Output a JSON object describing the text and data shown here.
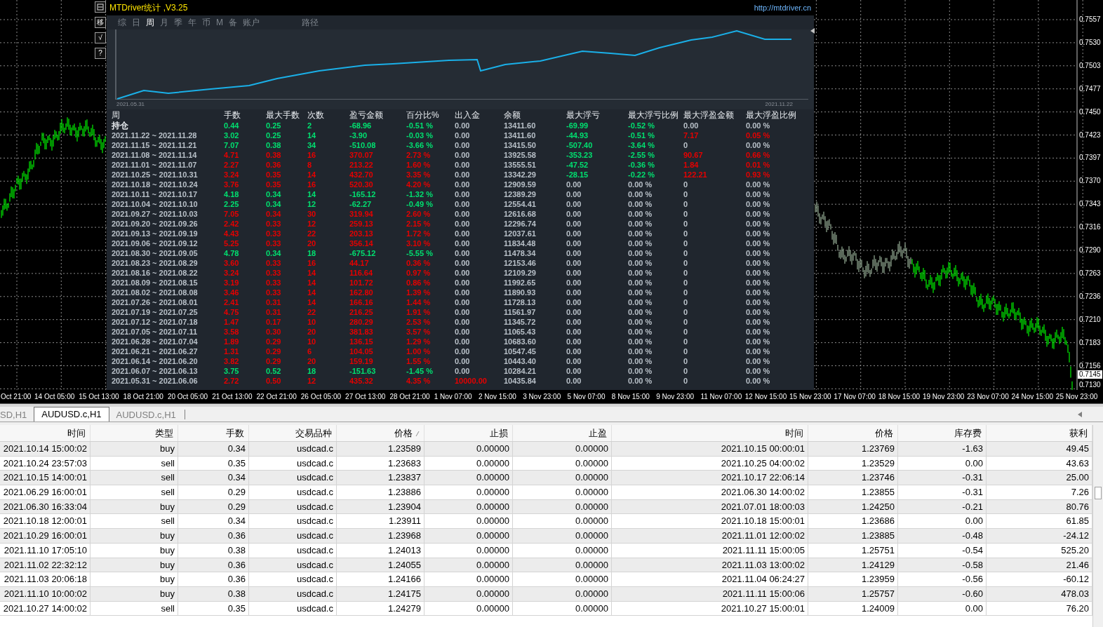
{
  "chart": {
    "price_ticks": [
      "0.7557",
      "0.7530",
      "0.7503",
      "0.7477",
      "0.7450",
      "0.7423",
      "0.7397",
      "0.7370",
      "0.7343",
      "0.7316",
      "0.7290",
      "0.7263",
      "0.7236",
      "0.7210",
      "0.7183",
      "0.7156",
      "0.7130"
    ],
    "current_price": "0.7145",
    "time_labels": [
      "Oct 21:00",
      "14 Oct 05:00",
      "15 Oct 13:00",
      "18 Oct 21:00",
      "20 Oct 05:00",
      "21 Oct 13:00",
      "22 Oct 21:00",
      "26 Oct 05:00",
      "27 Oct 13:00",
      "28 Oct 21:00",
      "1 Nov 07:00",
      "2 Nov 15:00",
      "3 Nov 23:00",
      "5 Nov 07:00",
      "8 Nov 15:00",
      "9 Nov 23:00",
      "11 Nov 07:00",
      "12 Nov 15:00",
      "15 Nov 23:00",
      "17 Nov 07:00",
      "18 Nov 15:00",
      "19 Nov 23:00",
      "23 Nov 07:00",
      "24 Nov 15:00",
      "25 Nov 23:00"
    ]
  },
  "panel": {
    "title": "MTDriver统计 ,V3.25",
    "url": "http://mtdriver.cn",
    "side_buttons": [
      {
        "kind": "minimize"
      },
      {
        "kind": "text",
        "label": "移"
      },
      {
        "kind": "text",
        "label": "√"
      },
      {
        "kind": "text",
        "label": "?"
      }
    ],
    "tabs": [
      {
        "label": "综",
        "selected": false
      },
      {
        "label": "日",
        "selected": false
      },
      {
        "label": "周",
        "selected": true
      },
      {
        "label": "月",
        "selected": false
      },
      {
        "label": "季",
        "selected": false
      },
      {
        "label": "年",
        "selected": false
      },
      {
        "label": "币",
        "selected": false
      },
      {
        "label": "M",
        "selected": false
      },
      {
        "label": "备",
        "selected": false
      },
      {
        "label": "账户",
        "selected": false
      }
    ],
    "path_label": "路径",
    "equity_chart": {
      "start_label": "2021.05.31",
      "end_label": "2021.11.22"
    },
    "stats": {
      "columns": [
        "周",
        "手数",
        "最大手数",
        "次数",
        "盈亏金额",
        "百分比%",
        "出入金",
        "余额",
        "最大浮亏",
        "最大浮亏比例",
        "最大浮盈金额",
        "最大浮盈比例"
      ],
      "rows": [
        [
          {
            "text": "持仓",
            "color": "#e8ecf0"
          },
          {
            "text": "0.44",
            "color": "#00e070"
          },
          {
            "text": "0.25",
            "color": "#00e070"
          },
          {
            "text": "2",
            "color": "#00e070"
          },
          {
            "text": "-68.96",
            "color": "#00e070"
          },
          {
            "text": "-0.51 %",
            "color": "#00e070"
          },
          {
            "text": "0.00",
            "color": "#b8c0c8"
          },
          {
            "text": "13411.60",
            "color": "#b8c0c8"
          },
          {
            "text": "-69.99",
            "color": "#00e070"
          },
          {
            "text": "-0.52 %",
            "color": "#00e070"
          },
          {
            "text": "0.00",
            "color": "#b8c0c8"
          },
          {
            "text": "0.00 %",
            "color": "#b8c0c8"
          }
        ],
        [
          {
            "text": "2021.11.22 ~ 2021.11.28",
            "color": "#b8c0c8"
          },
          {
            "text": "3.02",
            "color": "#00e070"
          },
          {
            "text": "0.25",
            "color": "#00e070"
          },
          {
            "text": "14",
            "color": "#00e070"
          },
          {
            "text": "-3.90",
            "color": "#00e070"
          },
          {
            "text": "-0.03 %",
            "color": "#00e070"
          },
          {
            "text": "0.00",
            "color": "#b8c0c8"
          },
          {
            "text": "13411.60",
            "color": "#b8c0c8"
          },
          {
            "text": "-44.93",
            "color": "#00e070"
          },
          {
            "text": "-0.51 %",
            "color": "#00e070"
          },
          {
            "text": "7.17",
            "color": "#e60000"
          },
          {
            "text": "0.05 %",
            "color": "#e60000"
          }
        ],
        [
          {
            "text": "2021.11.15 ~ 2021.11.21",
            "color": "#b8c0c8"
          },
          {
            "text": "7.07",
            "color": "#00e070"
          },
          {
            "text": "0.38",
            "color": "#00e070"
          },
          {
            "text": "34",
            "color": "#00e070"
          },
          {
            "text": "-510.08",
            "color": "#00e070"
          },
          {
            "text": "-3.66 %",
            "color": "#00e070"
          },
          {
            "text": "0.00",
            "color": "#b8c0c8"
          },
          {
            "text": "13415.50",
            "color": "#b8c0c8"
          },
          {
            "text": "-507.40",
            "color": "#00e070"
          },
          {
            "text": "-3.64 %",
            "color": "#00e070"
          },
          {
            "text": "0",
            "color": "#b8c0c8"
          },
          {
            "text": "0.00 %",
            "color": "#b8c0c8"
          }
        ],
        [
          {
            "text": "2021.11.08 ~ 2021.11.14",
            "color": "#b8c0c8"
          },
          {
            "text": "4.71",
            "color": "#e60000"
          },
          {
            "text": "0.38",
            "color": "#e60000"
          },
          {
            "text": "16",
            "color": "#e60000"
          },
          {
            "text": "370.07",
            "color": "#e60000"
          },
          {
            "text": "2.73 %",
            "color": "#e60000"
          },
          {
            "text": "0.00",
            "color": "#b8c0c8"
          },
          {
            "text": "13925.58",
            "color": "#b8c0c8"
          },
          {
            "text": "-353.23",
            "color": "#00e070"
          },
          {
            "text": "-2.55 %",
            "color": "#00e070"
          },
          {
            "text": "90.67",
            "color": "#e60000"
          },
          {
            "text": "0.66 %",
            "color": "#e60000"
          }
        ],
        [
          {
            "text": "2021.11.01 ~ 2021.11.07",
            "color": "#b8c0c8"
          },
          {
            "text": "2.27",
            "color": "#e60000"
          },
          {
            "text": "0.36",
            "color": "#e60000"
          },
          {
            "text": "8",
            "color": "#e60000"
          },
          {
            "text": "213.22",
            "color": "#e60000"
          },
          {
            "text": "1.60 %",
            "color": "#e60000"
          },
          {
            "text": "0.00",
            "color": "#b8c0c8"
          },
          {
            "text": "13555.51",
            "color": "#b8c0c8"
          },
          {
            "text": "-47.52",
            "color": "#00e070"
          },
          {
            "text": "-0.36 %",
            "color": "#00e070"
          },
          {
            "text": "1.84",
            "color": "#e60000"
          },
          {
            "text": "0.01 %",
            "color": "#e60000"
          }
        ],
        [
          {
            "text": "2021.10.25 ~ 2021.10.31",
            "color": "#b8c0c8"
          },
          {
            "text": "3.24",
            "color": "#e60000"
          },
          {
            "text": "0.35",
            "color": "#e60000"
          },
          {
            "text": "14",
            "color": "#e60000"
          },
          {
            "text": "432.70",
            "color": "#e60000"
          },
          {
            "text": "3.35 %",
            "color": "#e60000"
          },
          {
            "text": "0.00",
            "color": "#b8c0c8"
          },
          {
            "text": "13342.29",
            "color": "#b8c0c8"
          },
          {
            "text": "-28.15",
            "color": "#00e070"
          },
          {
            "text": "-0.22 %",
            "color": "#00e070"
          },
          {
            "text": "122.21",
            "color": "#e60000"
          },
          {
            "text": "0.93 %",
            "color": "#e60000"
          }
        ],
        [
          {
            "text": "2021.10.18 ~ 2021.10.24",
            "color": "#b8c0c8"
          },
          {
            "text": "3.76",
            "color": "#e60000"
          },
          {
            "text": "0.35",
            "color": "#e60000"
          },
          {
            "text": "16",
            "color": "#e60000"
          },
          {
            "text": "520.30",
            "color": "#e60000"
          },
          {
            "text": "4.20 %",
            "color": "#e60000"
          },
          {
            "text": "0.00",
            "color": "#b8c0c8"
          },
          {
            "text": "12909.59",
            "color": "#b8c0c8"
          },
          {
            "text": "0.00",
            "color": "#b8c0c8"
          },
          {
            "text": "0.00 %",
            "color": "#b8c0c8"
          },
          {
            "text": "0",
            "color": "#b8c0c8"
          },
          {
            "text": "0.00 %",
            "color": "#b8c0c8"
          }
        ],
        [
          {
            "text": "2021.10.11 ~ 2021.10.17",
            "color": "#b8c0c8"
          },
          {
            "text": "4.18",
            "color": "#00e070"
          },
          {
            "text": "0.34",
            "color": "#00e070"
          },
          {
            "text": "14",
            "color": "#00e070"
          },
          {
            "text": "-165.12",
            "color": "#00e070"
          },
          {
            "text": "-1.32 %",
            "color": "#00e070"
          },
          {
            "text": "0.00",
            "color": "#b8c0c8"
          },
          {
            "text": "12389.29",
            "color": "#b8c0c8"
          },
          {
            "text": "0.00",
            "color": "#b8c0c8"
          },
          {
            "text": "0.00 %",
            "color": "#b8c0c8"
          },
          {
            "text": "0",
            "color": "#b8c0c8"
          },
          {
            "text": "0.00 %",
            "color": "#b8c0c8"
          }
        ],
        [
          {
            "text": "2021.10.04 ~ 2021.10.10",
            "color": "#b8c0c8"
          },
          {
            "text": "2.25",
            "color": "#00e070"
          },
          {
            "text": "0.34",
            "color": "#00e070"
          },
          {
            "text": "12",
            "color": "#00e070"
          },
          {
            "text": "-62.27",
            "color": "#00e070"
          },
          {
            "text": "-0.49 %",
            "color": "#00e070"
          },
          {
            "text": "0.00",
            "color": "#b8c0c8"
          },
          {
            "text": "12554.41",
            "color": "#b8c0c8"
          },
          {
            "text": "0.00",
            "color": "#b8c0c8"
          },
          {
            "text": "0.00 %",
            "color": "#b8c0c8"
          },
          {
            "text": "0",
            "color": "#b8c0c8"
          },
          {
            "text": "0.00 %",
            "color": "#b8c0c8"
          }
        ],
        [
          {
            "text": "2021.09.27 ~ 2021.10.03",
            "color": "#b8c0c8"
          },
          {
            "text": "7.05",
            "color": "#e60000"
          },
          {
            "text": "0.34",
            "color": "#e60000"
          },
          {
            "text": "30",
            "color": "#e60000"
          },
          {
            "text": "319.94",
            "color": "#e60000"
          },
          {
            "text": "2.60 %",
            "color": "#e60000"
          },
          {
            "text": "0.00",
            "color": "#b8c0c8"
          },
          {
            "text": "12616.68",
            "color": "#b8c0c8"
          },
          {
            "text": "0.00",
            "color": "#b8c0c8"
          },
          {
            "text": "0.00 %",
            "color": "#b8c0c8"
          },
          {
            "text": "0",
            "color": "#b8c0c8"
          },
          {
            "text": "0.00 %",
            "color": "#b8c0c8"
          }
        ],
        [
          {
            "text": "2021.09.20 ~ 2021.09.26",
            "color": "#b8c0c8"
          },
          {
            "text": "2.42",
            "color": "#e60000"
          },
          {
            "text": "0.33",
            "color": "#e60000"
          },
          {
            "text": "12",
            "color": "#e60000"
          },
          {
            "text": "259.13",
            "color": "#e60000"
          },
          {
            "text": "2.15 %",
            "color": "#e60000"
          },
          {
            "text": "0.00",
            "color": "#b8c0c8"
          },
          {
            "text": "12296.74",
            "color": "#b8c0c8"
          },
          {
            "text": "0.00",
            "color": "#b8c0c8"
          },
          {
            "text": "0.00 %",
            "color": "#b8c0c8"
          },
          {
            "text": "0",
            "color": "#b8c0c8"
          },
          {
            "text": "0.00 %",
            "color": "#b8c0c8"
          }
        ],
        [
          {
            "text": "2021.09.13 ~ 2021.09.19",
            "color": "#b8c0c8"
          },
          {
            "text": "4.43",
            "color": "#e60000"
          },
          {
            "text": "0.33",
            "color": "#e60000"
          },
          {
            "text": "22",
            "color": "#e60000"
          },
          {
            "text": "203.13",
            "color": "#e60000"
          },
          {
            "text": "1.72 %",
            "color": "#e60000"
          },
          {
            "text": "0.00",
            "color": "#b8c0c8"
          },
          {
            "text": "12037.61",
            "color": "#b8c0c8"
          },
          {
            "text": "0.00",
            "color": "#b8c0c8"
          },
          {
            "text": "0.00 %",
            "color": "#b8c0c8"
          },
          {
            "text": "0",
            "color": "#b8c0c8"
          },
          {
            "text": "0.00 %",
            "color": "#b8c0c8"
          }
        ],
        [
          {
            "text": "2021.09.06 ~ 2021.09.12",
            "color": "#b8c0c8"
          },
          {
            "text": "5.25",
            "color": "#e60000"
          },
          {
            "text": "0.33",
            "color": "#e60000"
          },
          {
            "text": "20",
            "color": "#e60000"
          },
          {
            "text": "356.14",
            "color": "#e60000"
          },
          {
            "text": "3.10 %",
            "color": "#e60000"
          },
          {
            "text": "0.00",
            "color": "#b8c0c8"
          },
          {
            "text": "11834.48",
            "color": "#b8c0c8"
          },
          {
            "text": "0.00",
            "color": "#b8c0c8"
          },
          {
            "text": "0.00 %",
            "color": "#b8c0c8"
          },
          {
            "text": "0",
            "color": "#b8c0c8"
          },
          {
            "text": "0.00 %",
            "color": "#b8c0c8"
          }
        ],
        [
          {
            "text": "2021.08.30 ~ 2021.09.05",
            "color": "#b8c0c8"
          },
          {
            "text": "4.78",
            "color": "#00e070"
          },
          {
            "text": "0.34",
            "color": "#00e070"
          },
          {
            "text": "18",
            "color": "#00e070"
          },
          {
            "text": "-675.12",
            "color": "#00e070"
          },
          {
            "text": "-5.55 %",
            "color": "#00e070"
          },
          {
            "text": "0.00",
            "color": "#b8c0c8"
          },
          {
            "text": "11478.34",
            "color": "#b8c0c8"
          },
          {
            "text": "0.00",
            "color": "#b8c0c8"
          },
          {
            "text": "0.00 %",
            "color": "#b8c0c8"
          },
          {
            "text": "0",
            "color": "#b8c0c8"
          },
          {
            "text": "0.00 %",
            "color": "#b8c0c8"
          }
        ],
        [
          {
            "text": "2021.08.23 ~ 2021.08.29",
            "color": "#b8c0c8"
          },
          {
            "text": "3.60",
            "color": "#e60000"
          },
          {
            "text": "0.33",
            "color": "#e60000"
          },
          {
            "text": "16",
            "color": "#e60000"
          },
          {
            "text": "44.17",
            "color": "#e60000"
          },
          {
            "text": "0.36 %",
            "color": "#e60000"
          },
          {
            "text": "0.00",
            "color": "#b8c0c8"
          },
          {
            "text": "12153.46",
            "color": "#b8c0c8"
          },
          {
            "text": "0.00",
            "color": "#b8c0c8"
          },
          {
            "text": "0.00 %",
            "color": "#b8c0c8"
          },
          {
            "text": "0",
            "color": "#b8c0c8"
          },
          {
            "text": "0.00 %",
            "color": "#b8c0c8"
          }
        ],
        [
          {
            "text": "2021.08.16 ~ 2021.08.22",
            "color": "#b8c0c8"
          },
          {
            "text": "3.24",
            "color": "#e60000"
          },
          {
            "text": "0.33",
            "color": "#e60000"
          },
          {
            "text": "14",
            "color": "#e60000"
          },
          {
            "text": "116.64",
            "color": "#e60000"
          },
          {
            "text": "0.97 %",
            "color": "#e60000"
          },
          {
            "text": "0.00",
            "color": "#b8c0c8"
          },
          {
            "text": "12109.29",
            "color": "#b8c0c8"
          },
          {
            "text": "0.00",
            "color": "#b8c0c8"
          },
          {
            "text": "0.00 %",
            "color": "#b8c0c8"
          },
          {
            "text": "0",
            "color": "#b8c0c8"
          },
          {
            "text": "0.00 %",
            "color": "#b8c0c8"
          }
        ],
        [
          {
            "text": "2021.08.09 ~ 2021.08.15",
            "color": "#b8c0c8"
          },
          {
            "text": "3.19",
            "color": "#e60000"
          },
          {
            "text": "0.33",
            "color": "#e60000"
          },
          {
            "text": "14",
            "color": "#e60000"
          },
          {
            "text": "101.72",
            "color": "#e60000"
          },
          {
            "text": "0.86 %",
            "color": "#e60000"
          },
          {
            "text": "0.00",
            "color": "#b8c0c8"
          },
          {
            "text": "11992.65",
            "color": "#b8c0c8"
          },
          {
            "text": "0.00",
            "color": "#b8c0c8"
          },
          {
            "text": "0.00 %",
            "color": "#b8c0c8"
          },
          {
            "text": "0",
            "color": "#b8c0c8"
          },
          {
            "text": "0.00 %",
            "color": "#b8c0c8"
          }
        ],
        [
          {
            "text": "2021.08.02 ~ 2021.08.08",
            "color": "#b8c0c8"
          },
          {
            "text": "3.46",
            "color": "#e60000"
          },
          {
            "text": "0.33",
            "color": "#e60000"
          },
          {
            "text": "14",
            "color": "#e60000"
          },
          {
            "text": "162.80",
            "color": "#e60000"
          },
          {
            "text": "1.39 %",
            "color": "#e60000"
          },
          {
            "text": "0.00",
            "color": "#b8c0c8"
          },
          {
            "text": "11890.93",
            "color": "#b8c0c8"
          },
          {
            "text": "0.00",
            "color": "#b8c0c8"
          },
          {
            "text": "0.00 %",
            "color": "#b8c0c8"
          },
          {
            "text": "0",
            "color": "#b8c0c8"
          },
          {
            "text": "0.00 %",
            "color": "#b8c0c8"
          }
        ],
        [
          {
            "text": "2021.07.26 ~ 2021.08.01",
            "color": "#b8c0c8"
          },
          {
            "text": "2.41",
            "color": "#e60000"
          },
          {
            "text": "0.31",
            "color": "#e60000"
          },
          {
            "text": "14",
            "color": "#e60000"
          },
          {
            "text": "166.16",
            "color": "#e60000"
          },
          {
            "text": "1.44 %",
            "color": "#e60000"
          },
          {
            "text": "0.00",
            "color": "#b8c0c8"
          },
          {
            "text": "11728.13",
            "color": "#b8c0c8"
          },
          {
            "text": "0.00",
            "color": "#b8c0c8"
          },
          {
            "text": "0.00 %",
            "color": "#b8c0c8"
          },
          {
            "text": "0",
            "color": "#b8c0c8"
          },
          {
            "text": "0.00 %",
            "color": "#b8c0c8"
          }
        ],
        [
          {
            "text": "2021.07.19 ~ 2021.07.25",
            "color": "#b8c0c8"
          },
          {
            "text": "4.75",
            "color": "#e60000"
          },
          {
            "text": "0.31",
            "color": "#e60000"
          },
          {
            "text": "22",
            "color": "#e60000"
          },
          {
            "text": "216.25",
            "color": "#e60000"
          },
          {
            "text": "1.91 %",
            "color": "#e60000"
          },
          {
            "text": "0.00",
            "color": "#b8c0c8"
          },
          {
            "text": "11561.97",
            "color": "#b8c0c8"
          },
          {
            "text": "0.00",
            "color": "#b8c0c8"
          },
          {
            "text": "0.00 %",
            "color": "#b8c0c8"
          },
          {
            "text": "0",
            "color": "#b8c0c8"
          },
          {
            "text": "0.00 %",
            "color": "#b8c0c8"
          }
        ],
        [
          {
            "text": "2021.07.12 ~ 2021.07.18",
            "color": "#b8c0c8"
          },
          {
            "text": "1.47",
            "color": "#e60000"
          },
          {
            "text": "0.17",
            "color": "#e60000"
          },
          {
            "text": "10",
            "color": "#e60000"
          },
          {
            "text": "280.29",
            "color": "#e60000"
          },
          {
            "text": "2.53 %",
            "color": "#e60000"
          },
          {
            "text": "0.00",
            "color": "#b8c0c8"
          },
          {
            "text": "11345.72",
            "color": "#b8c0c8"
          },
          {
            "text": "0.00",
            "color": "#b8c0c8"
          },
          {
            "text": "0.00 %",
            "color": "#b8c0c8"
          },
          {
            "text": "0",
            "color": "#b8c0c8"
          },
          {
            "text": "0.00 %",
            "color": "#b8c0c8"
          }
        ],
        [
          {
            "text": "2021.07.05 ~ 2021.07.11",
            "color": "#b8c0c8"
          },
          {
            "text": "3.58",
            "color": "#e60000"
          },
          {
            "text": "0.30",
            "color": "#e60000"
          },
          {
            "text": "20",
            "color": "#e60000"
          },
          {
            "text": "381.83",
            "color": "#e60000"
          },
          {
            "text": "3.57 %",
            "color": "#e60000"
          },
          {
            "text": "0.00",
            "color": "#b8c0c8"
          },
          {
            "text": "11065.43",
            "color": "#b8c0c8"
          },
          {
            "text": "0.00",
            "color": "#b8c0c8"
          },
          {
            "text": "0.00 %",
            "color": "#b8c0c8"
          },
          {
            "text": "0",
            "color": "#b8c0c8"
          },
          {
            "text": "0.00 %",
            "color": "#b8c0c8"
          }
        ],
        [
          {
            "text": "2021.06.28 ~ 2021.07.04",
            "color": "#b8c0c8"
          },
          {
            "text": "1.89",
            "color": "#e60000"
          },
          {
            "text": "0.29",
            "color": "#e60000"
          },
          {
            "text": "10",
            "color": "#e60000"
          },
          {
            "text": "136.15",
            "color": "#e60000"
          },
          {
            "text": "1.29 %",
            "color": "#e60000"
          },
          {
            "text": "0.00",
            "color": "#b8c0c8"
          },
          {
            "text": "10683.60",
            "color": "#b8c0c8"
          },
          {
            "text": "0.00",
            "color": "#b8c0c8"
          },
          {
            "text": "0.00 %",
            "color": "#b8c0c8"
          },
          {
            "text": "0",
            "color": "#b8c0c8"
          },
          {
            "text": "0.00 %",
            "color": "#b8c0c8"
          }
        ],
        [
          {
            "text": "2021.06.21 ~ 2021.06.27",
            "color": "#b8c0c8"
          },
          {
            "text": "1.31",
            "color": "#e60000"
          },
          {
            "text": "0.29",
            "color": "#e60000"
          },
          {
            "text": "6",
            "color": "#e60000"
          },
          {
            "text": "104.05",
            "color": "#e60000"
          },
          {
            "text": "1.00 %",
            "color": "#e60000"
          },
          {
            "text": "0.00",
            "color": "#b8c0c8"
          },
          {
            "text": "10547.45",
            "color": "#b8c0c8"
          },
          {
            "text": "0.00",
            "color": "#b8c0c8"
          },
          {
            "text": "0.00 %",
            "color": "#b8c0c8"
          },
          {
            "text": "0",
            "color": "#b8c0c8"
          },
          {
            "text": "0.00 %",
            "color": "#b8c0c8"
          }
        ],
        [
          {
            "text": "2021.06.14 ~ 2021.06.20",
            "color": "#b8c0c8"
          },
          {
            "text": "3.82",
            "color": "#e60000"
          },
          {
            "text": "0.29",
            "color": "#e60000"
          },
          {
            "text": "20",
            "color": "#e60000"
          },
          {
            "text": "159.19",
            "color": "#e60000"
          },
          {
            "text": "1.55 %",
            "color": "#e60000"
          },
          {
            "text": "0.00",
            "color": "#b8c0c8"
          },
          {
            "text": "10443.40",
            "color": "#b8c0c8"
          },
          {
            "text": "0.00",
            "color": "#b8c0c8"
          },
          {
            "text": "0.00 %",
            "color": "#b8c0c8"
          },
          {
            "text": "0",
            "color": "#b8c0c8"
          },
          {
            "text": "0.00 %",
            "color": "#b8c0c8"
          }
        ],
        [
          {
            "text": "2021.06.07 ~ 2021.06.13",
            "color": "#b8c0c8"
          },
          {
            "text": "3.75",
            "color": "#00e070"
          },
          {
            "text": "0.52",
            "color": "#00e070"
          },
          {
            "text": "18",
            "color": "#00e070"
          },
          {
            "text": "-151.63",
            "color": "#00e070"
          },
          {
            "text": "-1.45 %",
            "color": "#00e070"
          },
          {
            "text": "0.00",
            "color": "#b8c0c8"
          },
          {
            "text": "10284.21",
            "color": "#b8c0c8"
          },
          {
            "text": "0.00",
            "color": "#b8c0c8"
          },
          {
            "text": "0.00 %",
            "color": "#b8c0c8"
          },
          {
            "text": "0",
            "color": "#b8c0c8"
          },
          {
            "text": "0.00 %",
            "color": "#b8c0c8"
          }
        ],
        [
          {
            "text": "2021.05.31 ~ 2021.06.06",
            "color": "#b8c0c8"
          },
          {
            "text": "2.72",
            "color": "#e60000"
          },
          {
            "text": "0.50",
            "color": "#e60000"
          },
          {
            "text": "12",
            "color": "#e60000"
          },
          {
            "text": "435.32",
            "color": "#e60000"
          },
          {
            "text": "4.35 %",
            "color": "#e60000"
          },
          {
            "text": "10000.00",
            "color": "#e60000"
          },
          {
            "text": "10435.84",
            "color": "#b8c0c8"
          },
          {
            "text": "0.00",
            "color": "#b8c0c8"
          },
          {
            "text": "0.00 %",
            "color": "#b8c0c8"
          },
          {
            "text": "0",
            "color": "#b8c0c8"
          },
          {
            "text": "0.00 %",
            "color": "#b8c0c8"
          }
        ]
      ]
    }
  },
  "bottom_tabs": [
    {
      "label": "SD,H1",
      "selected": false
    },
    {
      "label": "AUDUSD.c,H1",
      "selected": true
    },
    {
      "label": "AUDUSD.c,H1",
      "selected": false
    }
  ],
  "trades": {
    "columns": [
      {
        "label": "时间",
        "sorted": false
      },
      {
        "label": "类型",
        "sorted": false
      },
      {
        "label": "手数",
        "sorted": false
      },
      {
        "label": "交易品种",
        "sorted": false
      },
      {
        "label": "价格",
        "sorted": true
      },
      {
        "label": "止损",
        "sorted": false
      },
      {
        "label": "止盈",
        "sorted": false
      },
      {
        "label": "时间",
        "sorted": false
      },
      {
        "label": "价格",
        "sorted": false
      },
      {
        "label": "库存费",
        "sorted": false
      },
      {
        "label": "获利",
        "sorted": false
      }
    ],
    "rows": [
      [
        "2021.10.14 15:00:02",
        "buy",
        "0.34",
        "usdcad.c",
        "1.23589",
        "0.00000",
        "0.00000",
        "2021.10.15 00:00:01",
        "1.23769",
        "-1.63",
        "49.45"
      ],
      [
        "2021.10.24 23:57:03",
        "sell",
        "0.35",
        "usdcad.c",
        "1.23683",
        "0.00000",
        "0.00000",
        "2021.10.25 04:00:02",
        "1.23529",
        "0.00",
        "43.63"
      ],
      [
        "2021.10.15 14:00:01",
        "sell",
        "0.34",
        "usdcad.c",
        "1.23837",
        "0.00000",
        "0.00000",
        "2021.10.17 22:06:14",
        "1.23746",
        "-0.31",
        "25.00"
      ],
      [
        "2021.06.29 16:00:01",
        "sell",
        "0.29",
        "usdcad.c",
        "1.23886",
        "0.00000",
        "0.00000",
        "2021.06.30 14:00:02",
        "1.23855",
        "-0.31",
        "7.26"
      ],
      [
        "2021.06.30 16:33:04",
        "buy",
        "0.29",
        "usdcad.c",
        "1.23904",
        "0.00000",
        "0.00000",
        "2021.07.01 18:00:03",
        "1.24250",
        "-0.21",
        "80.76"
      ],
      [
        "2021.10.18 12:00:01",
        "sell",
        "0.34",
        "usdcad.c",
        "1.23911",
        "0.00000",
        "0.00000",
        "2021.10.18 15:00:01",
        "1.23686",
        "0.00",
        "61.85"
      ],
      [
        "2021.10.29 16:00:01",
        "buy",
        "0.36",
        "usdcad.c",
        "1.23968",
        "0.00000",
        "0.00000",
        "2021.11.01 12:00:02",
        "1.23885",
        "-0.48",
        "-24.12"
      ],
      [
        "2021.11.10 17:05:10",
        "buy",
        "0.38",
        "usdcad.c",
        "1.24013",
        "0.00000",
        "0.00000",
        "2021.11.11 15:00:05",
        "1.25751",
        "-0.54",
        "525.20"
      ],
      [
        "2021.11.02 22:32:12",
        "buy",
        "0.36",
        "usdcad.c",
        "1.24055",
        "0.00000",
        "0.00000",
        "2021.11.03 13:00:02",
        "1.24129",
        "-0.58",
        "21.46"
      ],
      [
        "2021.11.03 20:06:18",
        "buy",
        "0.36",
        "usdcad.c",
        "1.24166",
        "0.00000",
        "0.00000",
        "2021.11.04 06:24:27",
        "1.23959",
        "-0.56",
        "-60.12"
      ],
      [
        "2021.11.10 10:00:02",
        "buy",
        "0.38",
        "usdcad.c",
        "1.24175",
        "0.00000",
        "0.00000",
        "2021.11.11 15:00:06",
        "1.25757",
        "-0.60",
        "478.03"
      ],
      [
        "2021.10.27 14:00:02",
        "sell",
        "0.35",
        "usdcad.c",
        "1.24279",
        "0.00000",
        "0.00000",
        "2021.10.27 15:00:01",
        "1.24009",
        "0.00",
        "76.20"
      ]
    ]
  }
}
